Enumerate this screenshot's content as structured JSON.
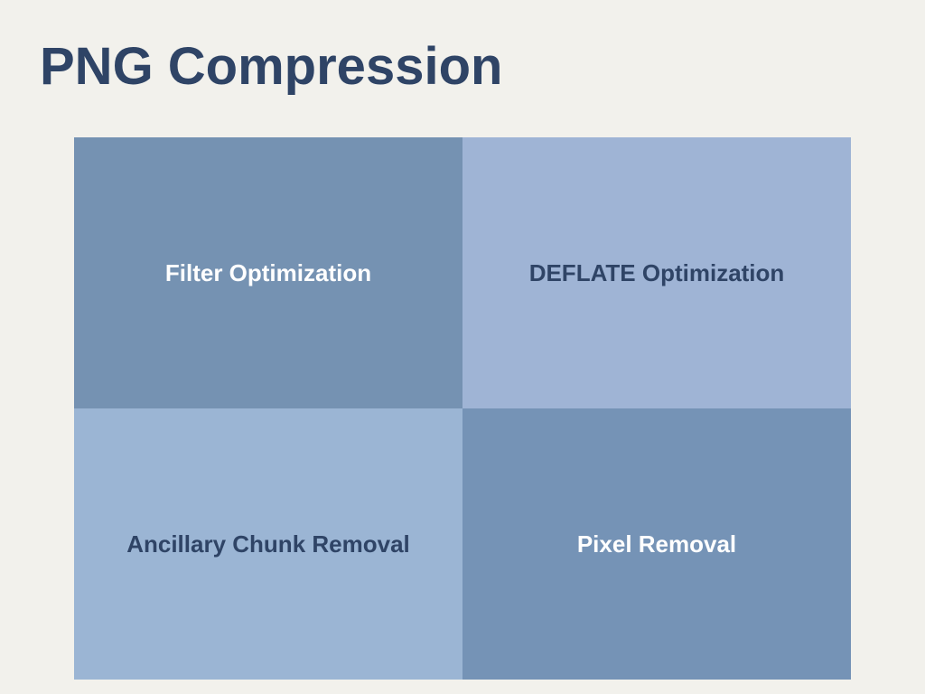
{
  "title": "PNG Compression",
  "cells": [
    "Filter Optimization",
    "DEFLATE Optimization",
    "Ancillary Chunk Removal",
    "Pixel Removal"
  ]
}
